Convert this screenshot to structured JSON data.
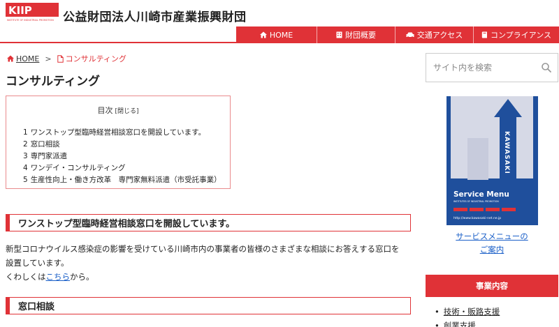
{
  "header": {
    "org_name": "公益財団法人川崎市産業振興財団",
    "logo_text": "KIIP",
    "logo_subtext": "INSTITUTE OF INDUSTRIAL PROMOTION"
  },
  "nav": {
    "items": [
      {
        "label": "HOME",
        "icon": "home-icon"
      },
      {
        "label": "財団概要",
        "icon": "building-icon"
      },
      {
        "label": "交通アクセス",
        "icon": "car-icon"
      },
      {
        "label": "コンプライアンス",
        "icon": "book-icon"
      }
    ]
  },
  "breadcrumb": {
    "home": "HOME",
    "separator": ">",
    "current": "コンサルティング"
  },
  "page_title": "コンサルティング",
  "toc": {
    "title": "目次",
    "toggle": "[閉じる]",
    "items": [
      {
        "num": "1",
        "label": "ワンストップ型臨時経営相談窓口を開設しています。"
      },
      {
        "num": "2",
        "label": "窓口相談"
      },
      {
        "num": "3",
        "label": "専門家派遣"
      },
      {
        "num": "4",
        "label": "ワンデイ・コンサルティング"
      },
      {
        "num": "5",
        "label": "生産性向上・働き方改革　専門家無料派遣（市受託事業）"
      }
    ]
  },
  "sections": [
    {
      "heading": "ワンストップ型臨時経営相談窓口を開設しています。"
    },
    {
      "heading": "窓口相談"
    }
  ],
  "paragraph": {
    "line1": "新型コロナウイルス感染症の影響を受けている川崎市内の事業者の皆様のさまざまな相談にお答えする窓口を",
    "line2": "設置しています。",
    "line3_prefix": "くわしくは",
    "line3_link": "こちら",
    "line3_suffix": "から。"
  },
  "sidebar": {
    "search_placeholder": "サイト内を検索",
    "banner": {
      "vertical_text": "KAWASAKI",
      "title": "Service Menu",
      "subtitle": "INSTITUTES OF INDUSTRIAL PROMOTION",
      "url": "http://www.kawasaki-net.ne.jp"
    },
    "service_link_line1": "サービスメニューの",
    "service_link_line2": "ご案内",
    "business_heading": "事業内容",
    "business_items": [
      "技術・販路支援",
      "創業支援"
    ]
  },
  "colors": {
    "accent": "#e03237",
    "link": "#1a5fc8",
    "banner_blue": "#1f4f9c",
    "banner_gray": "#d6d9e6"
  }
}
